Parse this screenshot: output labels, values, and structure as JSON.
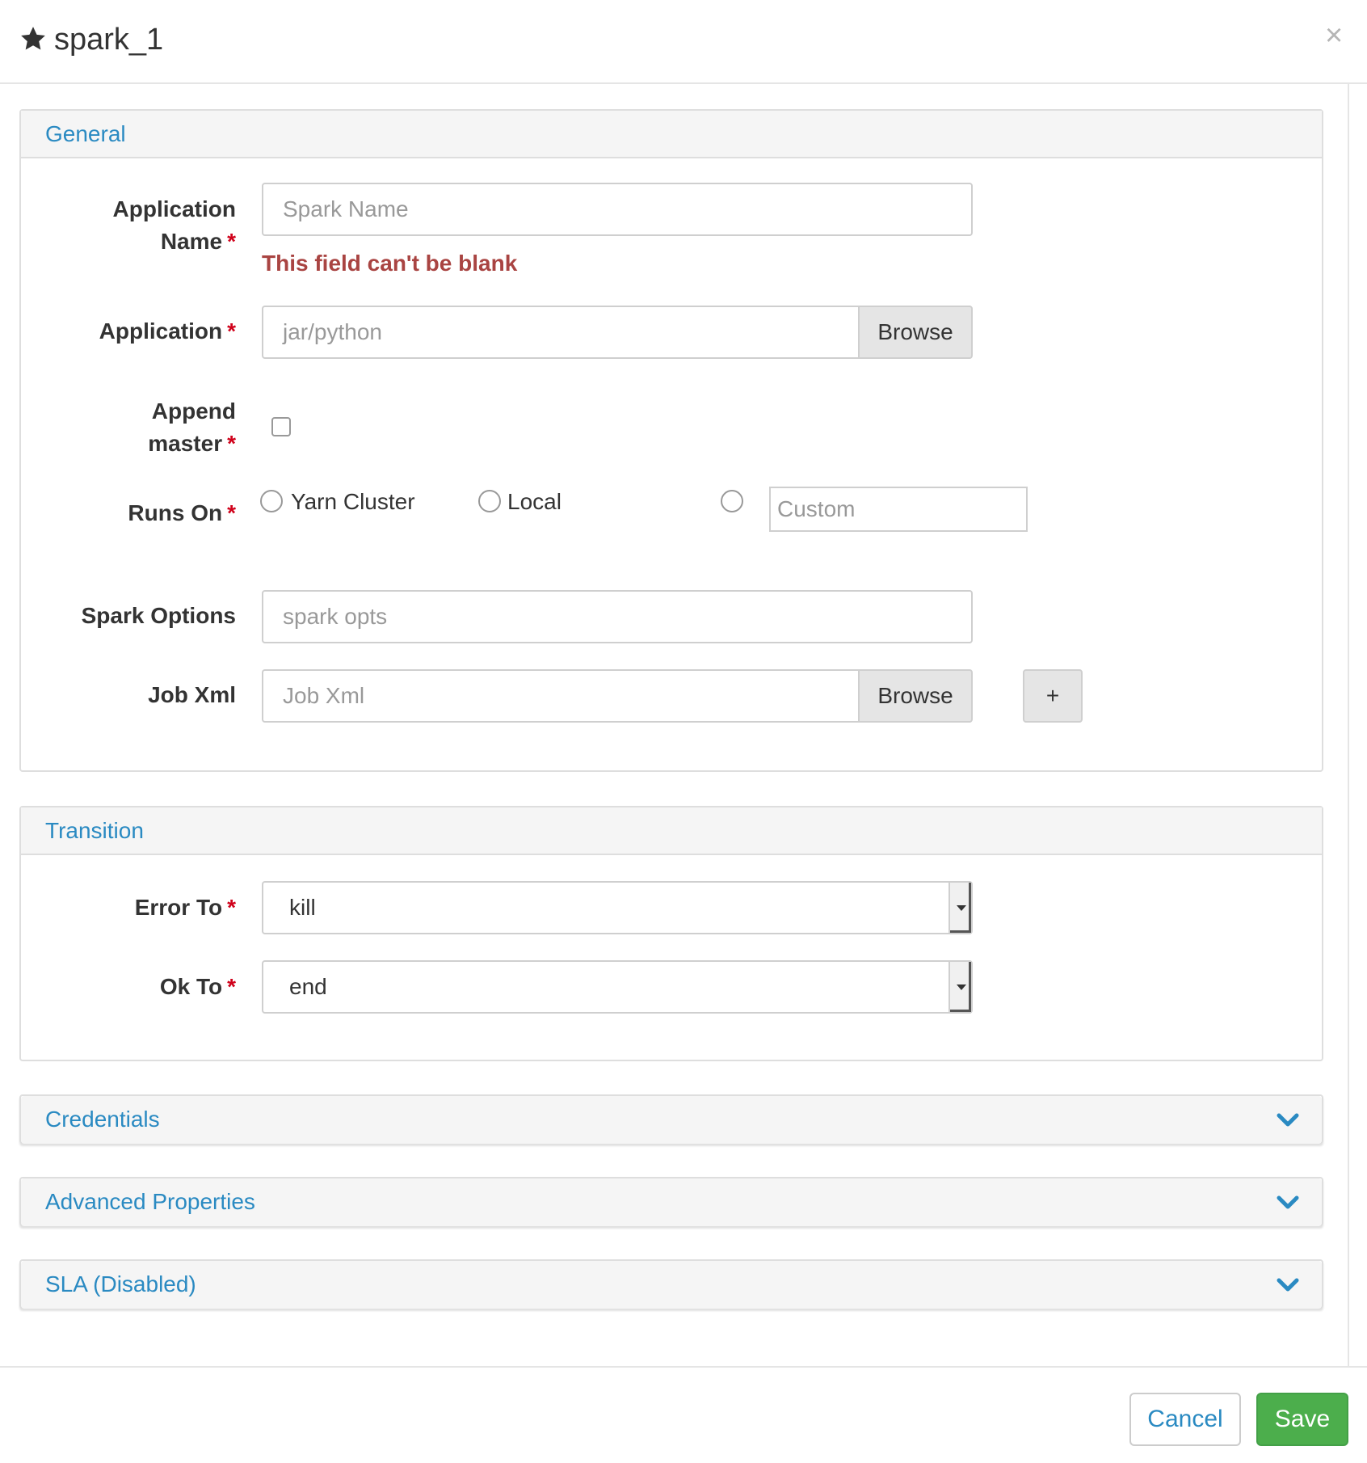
{
  "dialog": {
    "title": "spark_1",
    "close_glyph": "×",
    "icon": "star-icon"
  },
  "general": {
    "title": "General",
    "application_name": {
      "label_line1": "Application",
      "label_line2": "Name",
      "required_mark": "*",
      "placeholder": "Spark Name",
      "error": "This field can't be blank"
    },
    "application": {
      "label": "Application",
      "required_mark": "*",
      "placeholder": "jar/python",
      "browse_label": "Browse"
    },
    "append_master": {
      "label_line1": "Append",
      "label_line2": "master",
      "required_mark": "*",
      "checked": false
    },
    "runs_on": {
      "label": "Runs On",
      "required_mark": "*",
      "options": [
        "Yarn Cluster",
        "Local"
      ],
      "custom_placeholder": "Custom"
    },
    "spark_options": {
      "label": "Spark Options",
      "placeholder": "spark opts"
    },
    "job_xml": {
      "label": "Job Xml",
      "placeholder": "Job Xml",
      "browse_label": "Browse",
      "add_label": "+"
    }
  },
  "transition": {
    "title": "Transition",
    "error_to": {
      "label": "Error To",
      "required_mark": "*",
      "value": "kill"
    },
    "ok_to": {
      "label": "Ok To",
      "required_mark": "*",
      "value": "end"
    }
  },
  "collapsed_panels": [
    {
      "title": "Credentials",
      "icon": "chevron-down-icon"
    },
    {
      "title": "Advanced Properties",
      "icon": "chevron-down-icon"
    },
    {
      "title": "SLA (Disabled)",
      "icon": "chevron-down-icon"
    }
  ],
  "footer": {
    "cancel_label": "Cancel",
    "save_label": "Save"
  },
  "colors": {
    "link_blue": "#2a8ac2",
    "error_red": "#a94442",
    "required_red": "#d0021b",
    "save_green": "#4cae4c"
  }
}
